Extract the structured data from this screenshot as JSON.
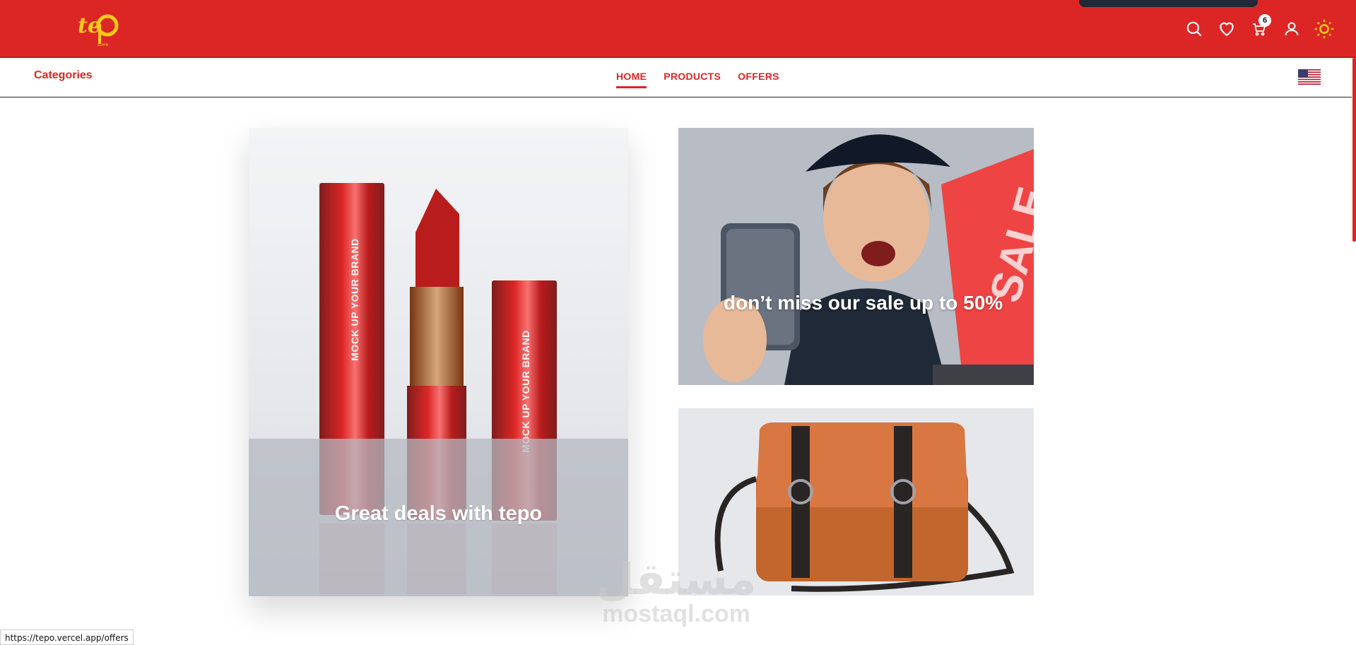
{
  "header": {
    "brand": "tepo",
    "cart_count": "6",
    "icons": [
      "search-icon",
      "heart-icon",
      "cart-icon",
      "user-icon",
      "sun-icon"
    ],
    "colors": {
      "primary": "#dc2626",
      "logo": "#facc15"
    }
  },
  "nav": {
    "categories_label": "Categories",
    "links": [
      {
        "label": "HOME",
        "active": true
      },
      {
        "label": "PRODUCTS",
        "active": false
      },
      {
        "label": "OFFERS",
        "active": false
      }
    ],
    "language_flag": "us-flag-icon"
  },
  "cards": {
    "left_caption": "Great deals with tepo",
    "sale_caption": "don’t miss our sale up to 50%",
    "lipstick_brand_text": "MOCK UP YOUR BRAND",
    "sale_bag_text": "SALE"
  },
  "status_bar": {
    "url": "https://tepo.vercel.app/offers"
  },
  "watermark": {
    "arabic": "مستقل",
    "latin": "mostaql.com"
  }
}
